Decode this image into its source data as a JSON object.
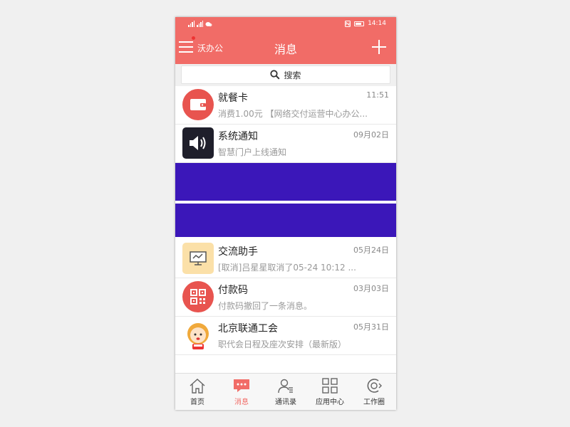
{
  "status_bar": {
    "time": "14:14"
  },
  "header": {
    "app_name": "沃办公",
    "title": "消息"
  },
  "search": {
    "label": "搜索"
  },
  "messages": [
    {
      "title": "就餐卡",
      "time": "11:51",
      "preview": "消费1.00元 【网络交付运营中心办公..."
    },
    {
      "title": "系统通知",
      "time": "09月02日",
      "preview": "智慧门户上线通知"
    },
    {
      "title": "交流助手",
      "time": "05月24日",
      "preview": "[取消]吕星星取消了05-24 10:12 ..."
    },
    {
      "title": "付款码",
      "time": "03月03日",
      "preview": "付款码撤回了一条消息。"
    },
    {
      "title": "北京联通工会",
      "time": "05月31日",
      "preview": "职代会日程及座次安排（最新版）"
    }
  ],
  "tabs": [
    {
      "label": "首页",
      "icon": "home-icon",
      "active": false
    },
    {
      "label": "消息",
      "icon": "chat-icon",
      "active": true
    },
    {
      "label": "通讯录",
      "icon": "contacts-icon",
      "active": false
    },
    {
      "label": "应用中心",
      "icon": "apps-icon",
      "active": false
    },
    {
      "label": "工作圈",
      "icon": "work-circle-icon",
      "active": false
    }
  ],
  "colors": {
    "brand": "#f16c67",
    "redaction": "#3b17b9"
  }
}
